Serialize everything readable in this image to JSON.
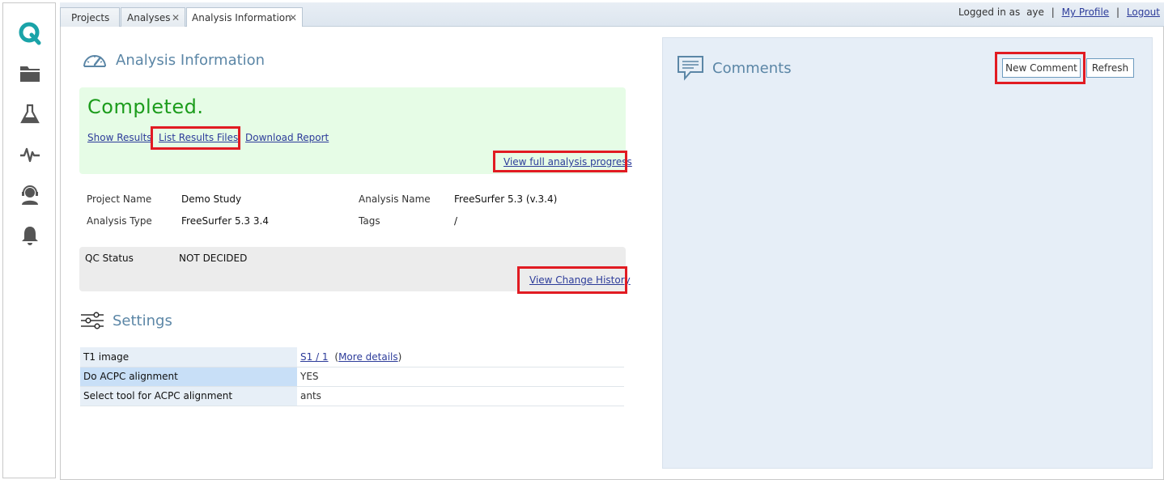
{
  "tabs": [
    {
      "label": "Projects",
      "closable": false
    },
    {
      "label": "Analyses",
      "closable": true
    },
    {
      "label": "Analysis Information",
      "closable": true,
      "active": true
    }
  ],
  "user": {
    "logged_in_prefix": "Logged in as",
    "username": "aye",
    "my_profile": "My Profile",
    "logout": "Logout",
    "separator": "|"
  },
  "nav_icons": [
    "logo-q-icon",
    "folder-icon",
    "flask-icon",
    "activity-pulse-icon",
    "support-agent-icon",
    "bell-icon"
  ],
  "analysis": {
    "heading": "Analysis Information",
    "status": "Completed.",
    "links": {
      "show_results": "Show Results",
      "list_results_files": "List Results Files",
      "download_report": "Download Report",
      "view_progress": "View full analysis progress"
    },
    "info": {
      "project_name_label": "Project Name",
      "project_name": "Demo Study",
      "analysis_name_label": "Analysis Name",
      "analysis_name": "FreeSurfer 5.3 (v.3.4)",
      "analysis_type_label": "Analysis Type",
      "analysis_type": "FreeSurfer 5.3 3.4",
      "tags_label": "Tags",
      "tags": "/"
    },
    "qc": {
      "label": "QC Status",
      "value": "NOT DECIDED",
      "history_link": "View Change History"
    }
  },
  "settings": {
    "heading": "Settings",
    "rows": [
      {
        "key": "T1 image",
        "value_link": "S1 / 1",
        "details_link": "More details",
        "open_paren": "(",
        "close_paren": ")"
      },
      {
        "key": "Do ACPC alignment",
        "value": "YES"
      },
      {
        "key": "Select tool for ACPC alignment",
        "value": "ants"
      }
    ]
  },
  "comments": {
    "heading": "Comments",
    "new_comment": "New Comment",
    "refresh": "Refresh"
  },
  "colors": {
    "accent": "#5b86a6",
    "status_green": "#1c9c1c",
    "highlight_red": "#e11b22",
    "link": "#2d3c9a",
    "logo_teal": "#1aa3a8"
  }
}
